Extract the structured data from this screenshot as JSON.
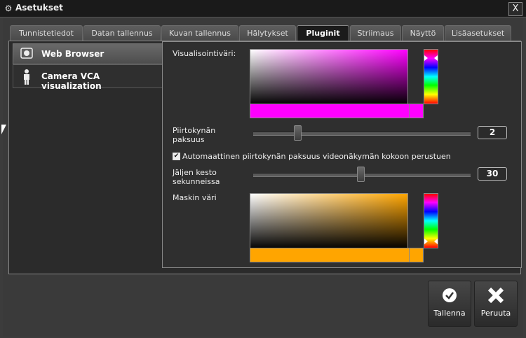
{
  "window": {
    "title": "Asetukset",
    "icon": "gear-icon",
    "close_label": "X"
  },
  "tabs": [
    {
      "label": "Tunnistetiedot",
      "active": false
    },
    {
      "label": "Datan tallennus",
      "active": false
    },
    {
      "label": "Kuvan tallennus",
      "active": false
    },
    {
      "label": "Hälytykset",
      "active": false
    },
    {
      "label": "Pluginit",
      "active": true
    },
    {
      "label": "Striimaus",
      "active": false
    },
    {
      "label": "Näyttö",
      "active": false
    },
    {
      "label": "Lisäasetukset",
      "active": false
    }
  ],
  "plugins": [
    {
      "label": "Web Browser",
      "icon": "globe-icon",
      "selected": true
    },
    {
      "label": "Camera VCA visualization",
      "icon": "person-icon",
      "selected": false
    }
  ],
  "settings": {
    "visualization_color_label": "Visualisointiväri:",
    "visualization_color": "#ff00ff",
    "pen_width_label_1": "Piirtokynän",
    "pen_width_label_2": "paksuus",
    "pen_width_value": "2",
    "pen_width_level": 0.2,
    "auto_pen_checkbox_label": "Automaattinen piirtokynän paksuus videonäkymän kokoon perustuen",
    "auto_pen_checked": true,
    "trail_duration_label_1": "Jäljen kesto",
    "trail_duration_label_2": "sekunneissa",
    "trail_duration_value": "30",
    "trail_duration_level": 0.49,
    "mask_color_label": "Maskin väri",
    "mask_color": "#ffa500"
  },
  "buttons": {
    "save_label": "Tallenna",
    "cancel_label": "Peruuta"
  }
}
